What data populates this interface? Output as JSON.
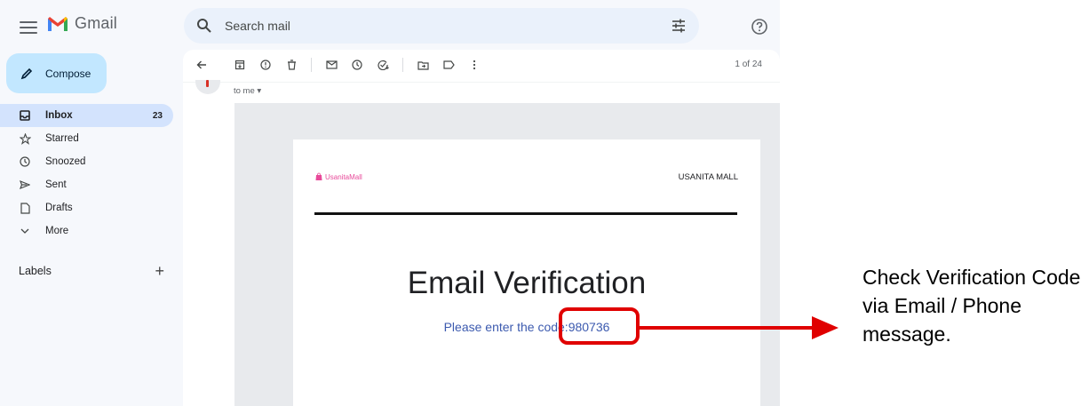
{
  "app": {
    "name": "Gmail"
  },
  "search": {
    "placeholder": "Search mail"
  },
  "compose": {
    "label": "Compose"
  },
  "sidebar": {
    "items": [
      {
        "label": "Inbox",
        "count": "23",
        "icon": "inbox-icon"
      },
      {
        "label": "Starred",
        "icon": "star-icon"
      },
      {
        "label": "Snoozed",
        "icon": "clock-icon"
      },
      {
        "label": "Sent",
        "icon": "send-icon"
      },
      {
        "label": "Drafts",
        "icon": "draft-icon"
      },
      {
        "label": "More",
        "icon": "chevron-down-icon"
      }
    ],
    "labels_heading": "Labels"
  },
  "toolbar": {
    "pager": "1 of 24"
  },
  "message": {
    "recipient": "to me",
    "brand_name": "UsanitaMall",
    "brand_right": "USANITA MALL",
    "headline": "Email Verification",
    "code_text": "Please enter the code:980736"
  },
  "annotation": {
    "callout": "Check Verification Code via Email / Phone message.",
    "color": "#e00000"
  },
  "colors": {
    "accent": "#c2e7ff",
    "active": "#d3e3fd",
    "link": "#3c5aaf",
    "brand": "#e84a9a"
  }
}
